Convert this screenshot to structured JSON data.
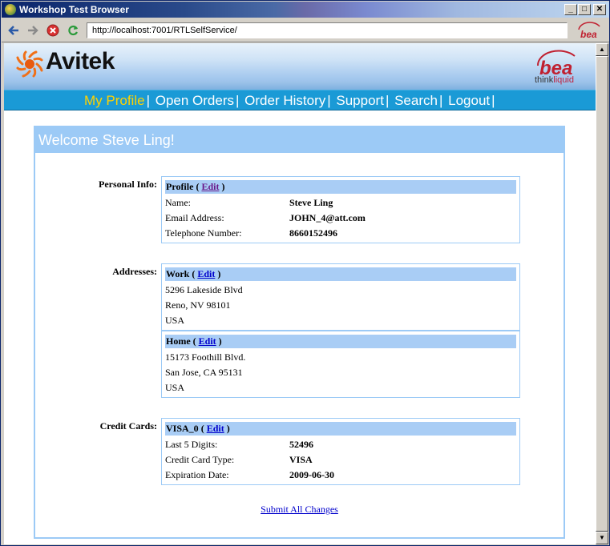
{
  "window": {
    "title": "Workshop Test Browser",
    "controls": {
      "minimize": "_",
      "maximize": "□",
      "close": "✕"
    }
  },
  "toolbar": {
    "address": "http://localhost:7001/RTLSelfService/",
    "back_icon": "arrow-left-icon",
    "forward_icon": "arrow-right-icon",
    "stop_icon": "stop-icon",
    "refresh_icon": "refresh-icon",
    "brand": "bea"
  },
  "banner": {
    "logo_text": "Avitek",
    "bea_logo": "bea",
    "bea_tag_think": "think",
    "bea_tag_liquid": "liquid"
  },
  "nav": {
    "items": [
      {
        "label": "My Profile",
        "active": true
      },
      {
        "label": "Open Orders"
      },
      {
        "label": "Order History"
      },
      {
        "label": "Support"
      },
      {
        "label": "Search"
      },
      {
        "label": "Logout"
      }
    ],
    "separator": "|"
  },
  "panel": {
    "welcome": "Welcome Steve Ling!",
    "personal": {
      "section_label": "Personal Info:",
      "header": "Profile",
      "edit": "Edit",
      "rows": [
        {
          "label": "Name:",
          "value": "Steve Ling"
        },
        {
          "label": "Email Address:",
          "value": "JOHN_4@att.com"
        },
        {
          "label": "Telephone Number:",
          "value": "8660152496"
        }
      ]
    },
    "addresses": {
      "section_label": "Addresses:",
      "work": {
        "header": "Work",
        "edit": "Edit",
        "lines": [
          "5296 Lakeside Blvd",
          "Reno, NV 98101",
          "USA"
        ]
      },
      "home": {
        "header": "Home",
        "edit": "Edit",
        "lines": [
          "15173 Foothill Blvd.",
          "San Jose, CA 95131",
          "USA"
        ]
      }
    },
    "credit": {
      "section_label": "Credit Cards:",
      "header": "VISA_0",
      "edit": "Edit",
      "rows": [
        {
          "label": "Last 5 Digits:",
          "value": "52496"
        },
        {
          "label": "Credit Card Type:",
          "value": "VISA"
        },
        {
          "label": "Expiration Date:",
          "value": "2009-06-30"
        }
      ]
    },
    "submit_link": "Submit All Changes"
  },
  "scrollbar": {
    "up_icon": "scroll-up-icon",
    "down_icon": "scroll-down-icon"
  },
  "colors": {
    "nav_bg": "#1a9ad6",
    "nav_active": "#ffd200",
    "panel_border": "#9ccaf6",
    "box_head": "#a9cdf5",
    "link": "#0000cc"
  }
}
